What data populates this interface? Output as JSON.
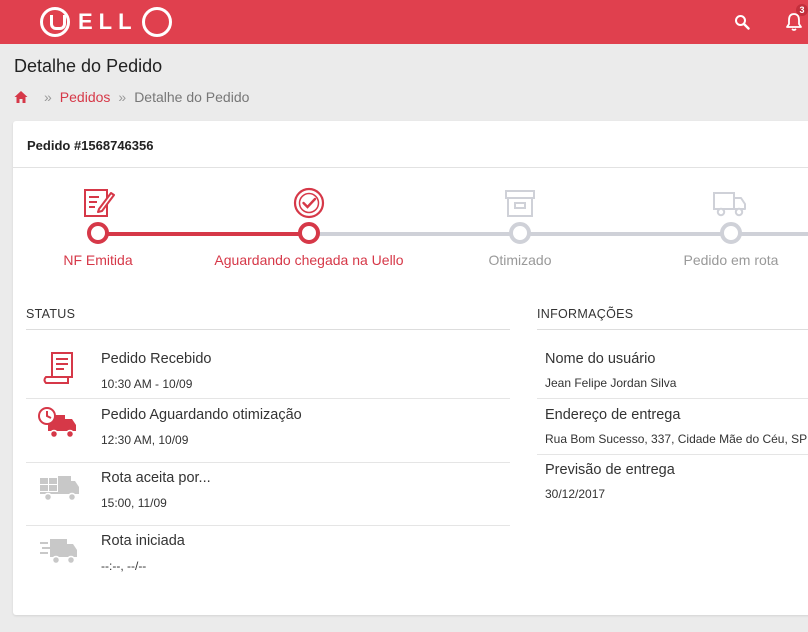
{
  "app": {
    "brand": "ELL",
    "notification_count": "3"
  },
  "page": {
    "title": "Detalhe do Pedido"
  },
  "breadcrumb": {
    "link": "Pedidos",
    "separator": "»",
    "current": "Detalhe do Pedido"
  },
  "order": {
    "title": "Pedido #1568746356"
  },
  "progress": {
    "steps": [
      {
        "label": "NF Emitida",
        "icon": "invoice-icon",
        "active": true
      },
      {
        "label": "Aguardando chegada na Uello",
        "icon": "check-circle-icon",
        "active": true
      },
      {
        "label": "Otimizado",
        "icon": "archive-box-icon",
        "active": false
      },
      {
        "label": "Pedido em rota",
        "icon": "truck-icon",
        "active": false
      }
    ]
  },
  "status": {
    "title": "STATUS",
    "items": [
      {
        "title": "Pedido Recebido",
        "time": "10:30 AM - 10/09",
        "icon": "receipt-icon",
        "active": true
      },
      {
        "title": "Pedido Aguardando otimização",
        "time": "12:30 AM, 10/09",
        "icon": "clock-truck-icon",
        "active": true
      },
      {
        "title": "Rota aceita por...",
        "time": "15:00, 11/09",
        "icon": "loaded-truck-icon",
        "active": false
      },
      {
        "title": "Rota iniciada",
        "time": "--:--, --/--",
        "icon": "fast-truck-icon",
        "active": false
      }
    ]
  },
  "info": {
    "title": "INFORMAÇÕES",
    "items": [
      {
        "label": "Nome do usuário",
        "value": "Jean Felipe Jordan Silva"
      },
      {
        "label": "Endereço de entrega",
        "value": "Rua Bom Sucesso, 337, Cidade Mãe do Céu, SP"
      },
      {
        "label": "Previsão de entrega",
        "value": "30/12/2017"
      }
    ]
  },
  "colors": {
    "brand": "#e0404e",
    "accent": "#d63848",
    "inactive": "#cfd1d8",
    "inactive_text": "#999999"
  }
}
